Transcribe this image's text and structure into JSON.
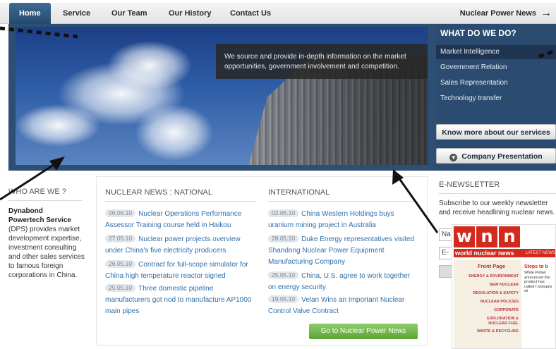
{
  "nav": {
    "items": [
      {
        "label": "Home",
        "active": true
      },
      {
        "label": "Service"
      },
      {
        "label": "Our Team"
      },
      {
        "label": "Our History"
      },
      {
        "label": "Contact Us"
      }
    ],
    "news_link": "Nuclear Power News",
    "news_arrow": "→"
  },
  "hero": {
    "overlay_text": "We source and provide in-depth information on the market opportunities, government involvement and competition."
  },
  "services": {
    "title": "WHAT DO WE DO?",
    "items": [
      "Market Intelligence",
      "Government Relation",
      "Sales Representation",
      "Technology transfer"
    ],
    "know_more": "Know more about our services",
    "presentation": "Company Presentation"
  },
  "who": {
    "title": "WHO ARE WE ?",
    "name_line1": "Dynabond",
    "name_line2": "Powertech Service",
    "body": "(DPS) provides market development expertise, investment consulting and other sales services to famous foreign corporations in China."
  },
  "national": {
    "title": "NUCLEAR NEWS : NATIONAL",
    "items": [
      {
        "date": "06.06.10",
        "text": "Nuclear Operations Performance Assessor Training course held in Haikou"
      },
      {
        "date": "27.05.10",
        "text": "Nuclear power projects overview under China's five electricity producers"
      },
      {
        "date": "26.05.10",
        "text": "Contract for full-scope simulator for China high temperature reactor signed"
      },
      {
        "date": "25.05.10",
        "text": "Three domestic pipeline manufacturers got nod to manufacture AP1000 main pipes"
      }
    ]
  },
  "international": {
    "title": "INTERNATIONAL",
    "items": [
      {
        "date": "02.06.10",
        "text": "China Western Holdings buys uranium mining project in Australia"
      },
      {
        "date": "28.05.10",
        "text": "Duke Energy representatives visited Shandong Nuclear Power Equipment Manufacturing Company"
      },
      {
        "date": "25.05.10",
        "text": "China, U.S. agree to work together on energy security"
      },
      {
        "date": "19.05.10",
        "text": "Velan Wins an Important Nuclear Control Valve Contract"
      }
    ],
    "go_button": "Go to Nuclear Power News"
  },
  "enews": {
    "title": "E-NEWSLETTER",
    "text": "Subscribe to our weekly newsletter and receive headlining nuclear news.",
    "name_placeholder": "Na",
    "email_placeholder": "E-"
  },
  "wnn": {
    "letters": [
      "w",
      "n",
      "n"
    ],
    "brand": "world nuclear news",
    "latest": "LATEST NEWS",
    "front_page": "Front Page",
    "side_links": [
      "ENERGY & ENVIRONMENT",
      "NEW NUCLEAR",
      "REGULATION & SAFETY",
      "NUCLEAR POLICIES",
      "CORPORATE",
      "EXPLORATION & NUCLEAR FUEL",
      "WASTE & RECYCLING"
    ],
    "main_head": "Steps to b",
    "main_text": "While Petsel announced the product has called f isotopes wi"
  },
  "colors": {
    "nav_active": "#2d557d",
    "panel_blue": "#2b4c70",
    "link_blue": "#2f6eab",
    "go_green": "#6cb544",
    "wnn_red": "#d32a1e"
  }
}
